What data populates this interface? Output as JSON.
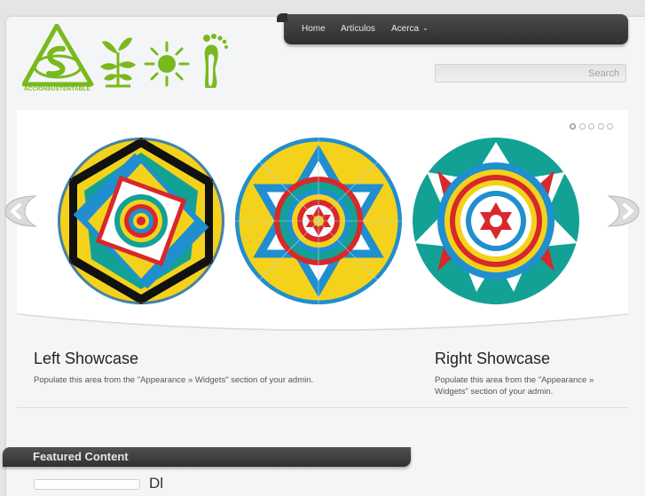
{
  "nav": {
    "items": [
      "Home",
      "Artículos",
      "Acerca"
    ]
  },
  "logo": {
    "text": "ACCIONSUSTENTABLE"
  },
  "search": {
    "button_label": "Search"
  },
  "slider": {
    "dot_count": 5,
    "active_dot": 1
  },
  "showcase": {
    "left": {
      "title": "Left Showcase",
      "line1": "Populate this area from the \"Appearance » Widgets\" section of your admin.",
      "line2": ""
    },
    "right": {
      "title": "Right Showcase",
      "line1": "Populate this area from the \"Appearance »",
      "line2": "Widgets\" section of your admin."
    }
  },
  "featured": {
    "label": "Featured Content",
    "first_post_title_partial": "Dl"
  },
  "colors": {
    "brand_green": "#7ab91e",
    "nav_dark": "#2e2f31",
    "mandala_blue": "#1f8fd0",
    "mandala_yellow": "#f4d21c",
    "mandala_red": "#d8282b",
    "mandala_teal": "#13a195",
    "mandala_black": "#111111"
  }
}
